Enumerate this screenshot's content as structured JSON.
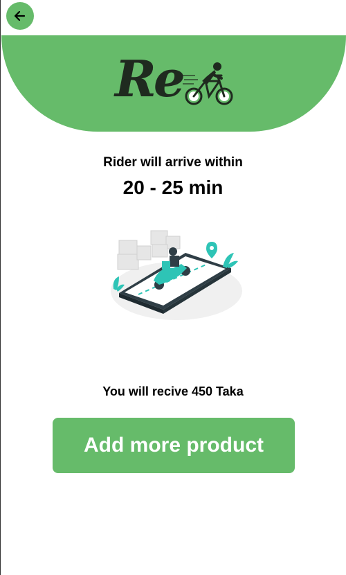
{
  "colors": {
    "brand": "#66bb6a",
    "text": "#000000",
    "button_text": "#ffffff"
  },
  "header": {
    "back_icon": "arrow-left-icon",
    "logo": {
      "text": "Re",
      "icon": "cyclist-icon"
    }
  },
  "delivery": {
    "label": "Rider will arrive within",
    "time": "20 - 25 min"
  },
  "illustration": {
    "icon": "scooter-delivery-illustration"
  },
  "payout": {
    "text": "You will recive 450 Taka"
  },
  "actions": {
    "add_more_label": "Add more product"
  }
}
